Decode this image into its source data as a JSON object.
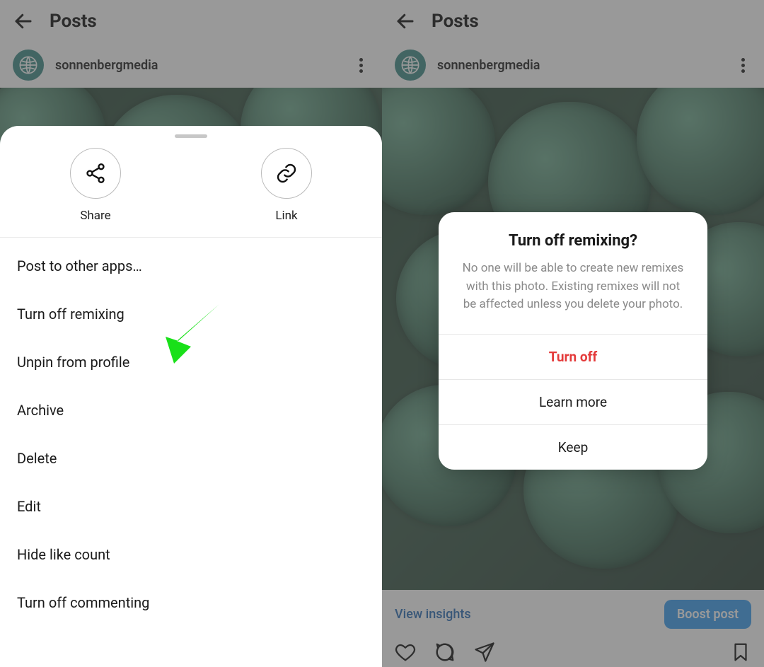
{
  "left": {
    "header": {
      "title": "Posts"
    },
    "user": {
      "name": "sonnenbergmedia"
    },
    "sheet": {
      "share_label": "Share",
      "link_label": "Link",
      "menu": {
        "post_other": "Post to other apps…",
        "turn_off_remix": "Turn off remixing",
        "unpin": "Unpin from profile",
        "archive": "Archive",
        "delete": "Delete",
        "edit": "Edit",
        "hide_likes": "Hide like count",
        "turn_off_comment": "Turn off commenting"
      }
    }
  },
  "right": {
    "header": {
      "title": "Posts"
    },
    "user": {
      "name": "sonnenbergmedia"
    },
    "insights_label": "View insights",
    "boost_label": "Boost post",
    "dialog": {
      "title": "Turn off remixing?",
      "body": "No one will be able to create new remixes with this photo. Existing remixes will not be affected unless you delete your photo.",
      "turn_off": "Turn off",
      "learn_more": "Learn more",
      "keep": "Keep"
    }
  }
}
